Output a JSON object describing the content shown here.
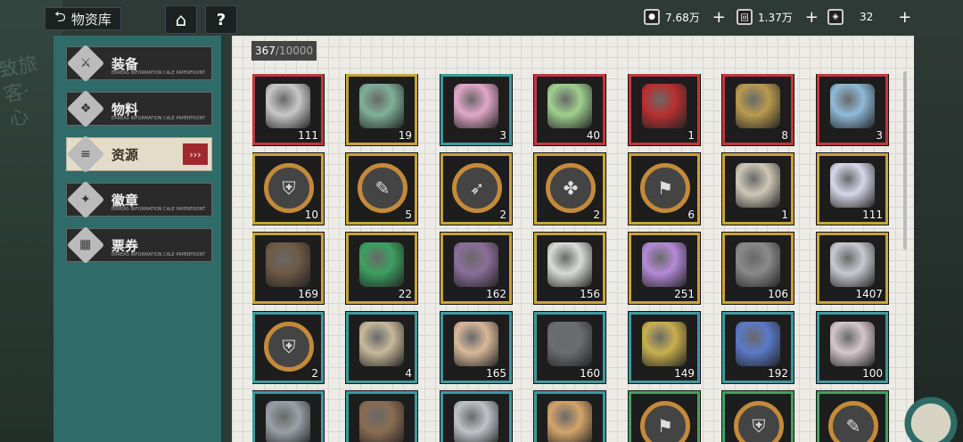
{
  "topbar": {
    "back_label": "物资库",
    "currencies": [
      {
        "icon": "coin-icon",
        "value": "7.68万"
      },
      {
        "icon": "ticket-icon",
        "value": "1.37万"
      },
      {
        "icon": "gem-icon",
        "value": "32"
      }
    ]
  },
  "sidebar": {
    "items": [
      {
        "label": "装备",
        "icon": "equipment-icon",
        "sub": "ERREAS INFORMATION CALE PAPERFRONT",
        "active": false
      },
      {
        "label": "物料",
        "icon": "materials-icon",
        "sub": "ERREAS INFORMATION CALE PAPERFRONT",
        "active": false
      },
      {
        "label": "资源",
        "icon": "resources-icon",
        "sub": "",
        "active": true
      },
      {
        "label": "徽章",
        "icon": "badge-icon",
        "sub": "ERREAS INFORMATION CALE PAPERFRONT",
        "active": false
      },
      {
        "label": "票券",
        "icon": "ticket-icon",
        "sub": "ERREAS INFORMATION CALE PAPERFRONT",
        "active": false
      }
    ]
  },
  "inventory": {
    "count": "367",
    "capacity": "/10000",
    "rows": [
      [
        {
          "qty": "111",
          "frame": "red",
          "color": "#c8c8c8"
        },
        {
          "qty": "19",
          "frame": "gold",
          "color": "#7fb09a"
        },
        {
          "qty": "3",
          "frame": "teal",
          "color": "#e2a7c8"
        },
        {
          "qty": "40",
          "frame": "red",
          "color": "#9fd08e"
        },
        {
          "qty": "1",
          "frame": "red",
          "color": "#b8312f"
        },
        {
          "qty": "8",
          "frame": "red",
          "color": "#b99a4f"
        },
        {
          "qty": "3",
          "frame": "red",
          "color": "#8fbad8"
        }
      ],
      [
        {
          "qty": "10",
          "frame": "gold",
          "ring": true
        },
        {
          "qty": "5",
          "frame": "gold",
          "ring": true
        },
        {
          "qty": "2",
          "frame": "gold",
          "ring": true
        },
        {
          "qty": "2",
          "frame": "gold",
          "ring": true
        },
        {
          "qty": "6",
          "frame": "gold",
          "ring": true
        },
        {
          "qty": "1",
          "frame": "gold",
          "color": "#cfc7b6"
        },
        {
          "qty": "111",
          "frame": "gold",
          "color": "#d6d6e8"
        }
      ],
      [
        {
          "qty": "169",
          "frame": "gold",
          "color": "#6e5a44"
        },
        {
          "qty": "22",
          "frame": "gold",
          "color": "#3ca060"
        },
        {
          "qty": "162",
          "frame": "gold",
          "color": "#8b6f9a"
        },
        {
          "qty": "156",
          "frame": "gold",
          "color": "#d8dcd6"
        },
        {
          "qty": "251",
          "frame": "gold",
          "color": "#b48ad6"
        },
        {
          "qty": "106",
          "frame": "gold",
          "color": "#8a8a8a"
        },
        {
          "qty": "1407",
          "frame": "gold",
          "color": "#c6cbd2"
        }
      ],
      [
        {
          "qty": "2",
          "frame": "teal",
          "ring": true
        },
        {
          "qty": "4",
          "frame": "teal",
          "color": "#c7b99b"
        },
        {
          "qty": "165",
          "frame": "teal",
          "color": "#d8b89a"
        },
        {
          "qty": "160",
          "frame": "teal",
          "color": "#6a6e70"
        },
        {
          "qty": "149",
          "frame": "teal",
          "color": "#c9b04f"
        },
        {
          "qty": "192",
          "frame": "teal",
          "color": "#5a7ac8"
        },
        {
          "qty": "100",
          "frame": "teal",
          "color": "#d6c7cc"
        }
      ],
      [
        {
          "qty": "",
          "frame": "teal",
          "color": "#9aa0a8"
        },
        {
          "qty": "",
          "frame": "teal",
          "color": "#8a6d52"
        },
        {
          "qty": "",
          "frame": "teal",
          "color": "#bfc3c8"
        },
        {
          "qty": "",
          "frame": "teal",
          "color": "#d3a46a"
        },
        {
          "qty": "",
          "frame": "green",
          "ring": true
        },
        {
          "qty": "",
          "frame": "green",
          "ring": true
        },
        {
          "qty": "",
          "frame": "green",
          "ring": true
        }
      ]
    ]
  },
  "colors": {
    "panel_teal": "#2f6b68",
    "active_tab": "#e4dcc8",
    "accent_red": "#a0292f"
  }
}
